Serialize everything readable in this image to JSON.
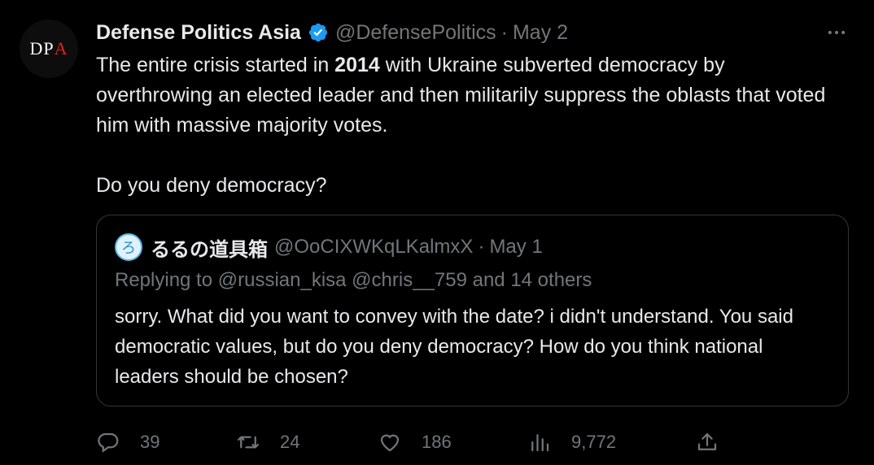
{
  "author": {
    "avatar_text": "DP",
    "avatar_accent": "A",
    "name": "Defense Politics Asia",
    "handle": "@DefensePolitics",
    "separator": "·",
    "date": "May 2"
  },
  "tweet": {
    "line1_before": "The entire crisis started in ",
    "line1_bold": "2014",
    "line1_after": " with Ukraine subverted democracy by overthrowing an elected leader and then militarily suppress the oblasts that voted him with massive majority votes.",
    "line2": "Do you deny democracy?"
  },
  "quote": {
    "name": "るるの道具箱",
    "handle": "@OoCIXWKqLKalmxX",
    "separator": "·",
    "date": "May 1",
    "replying": "Replying to @russian_kisa @chris__759 and 14 others",
    "text": "sorry.  What did you want to convey with the date?  i didn't understand. You said democratic values, but do you deny democracy?  How do you think national leaders should be chosen?"
  },
  "actions": {
    "replies": "39",
    "retweets": "24",
    "likes": "186",
    "views": "9,772"
  },
  "colors": {
    "background": "#000000",
    "text": "#e7e9ea",
    "muted": "#71767b",
    "verified": "#1d9bf0",
    "border": "#333639"
  },
  "icons": {
    "more": "more-icon",
    "verified": "verified-badge-icon",
    "reply": "reply-icon",
    "retweet": "retweet-icon",
    "like": "heart-icon",
    "views": "views-icon",
    "share": "share-icon"
  }
}
